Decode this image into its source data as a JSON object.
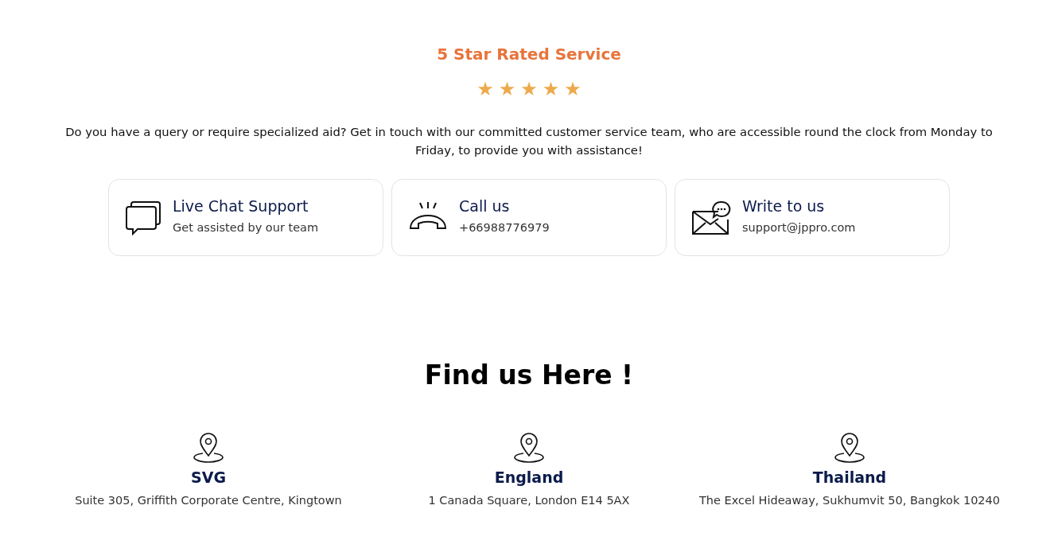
{
  "rating": {
    "title": "5 Star Rated Service",
    "stars": 5
  },
  "intro": "Do you have a query or require specialized aid? Get in touch with our committed customer service team, who are accessible round the clock from Monday to Friday, to provide you with assistance!",
  "contacts": [
    {
      "kind": "chat",
      "title": "Live Chat Support",
      "detail": "Get assisted by our team"
    },
    {
      "kind": "phone",
      "title": "Call us",
      "detail": "+66988776979"
    },
    {
      "kind": "mail",
      "title": "Write to us",
      "detail": "support@jppro.com"
    }
  ],
  "locations_title": "Find us Here !",
  "locations": [
    {
      "name": "SVG",
      "address": "Suite 305, Griffith Corporate Centre, Kingtown"
    },
    {
      "name": "England",
      "address": "1 Canada Square, London E14 5AX"
    },
    {
      "name": "Thailand",
      "address": "The Excel Hideaway, Sukhumvit 50, Bangkok 10240"
    }
  ]
}
